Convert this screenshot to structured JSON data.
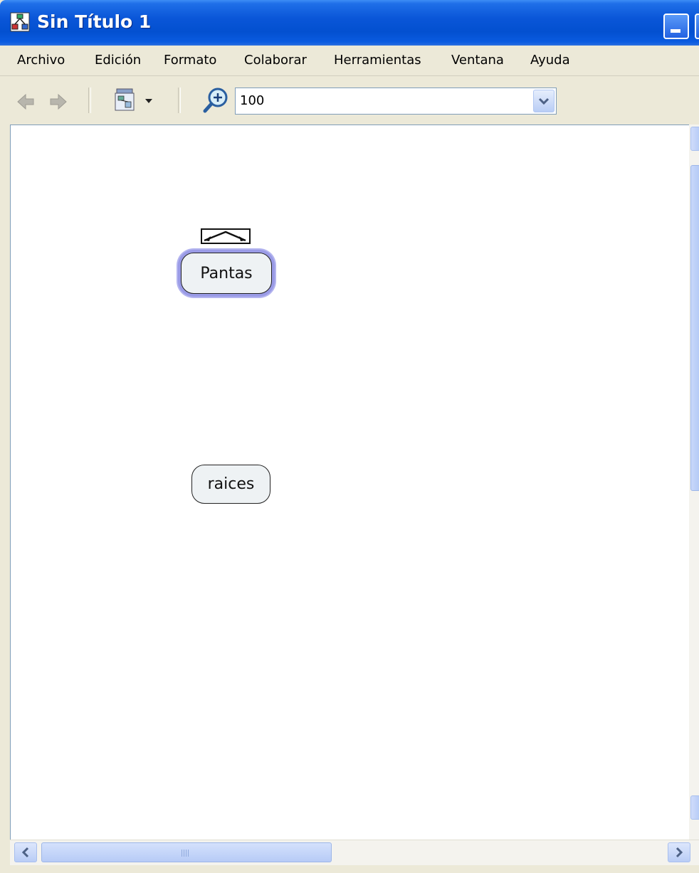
{
  "window": {
    "title": "Sin Título 1",
    "icon": "concept-map-app-icon"
  },
  "menubar": {
    "items": [
      "Archivo",
      "Edición",
      "Formato",
      "Colaborar",
      "Herramientas",
      "Ventana",
      "Ayuda"
    ]
  },
  "toolbar": {
    "back_icon": "arrow-left-icon",
    "forward_icon": "arrow-right-icon",
    "views_icon": "views-dropdown-icon",
    "zoom_icon": "zoom-in-icon",
    "zoom_value": "100"
  },
  "canvas": {
    "nodes": [
      {
        "label": "Pantas",
        "selected": true
      },
      {
        "label": "raices",
        "selected": false
      }
    ]
  },
  "colors": {
    "titlebar": "#0a56d8",
    "selection_halo": "#9a9be6",
    "node_fill": "#eef2f4",
    "chrome": "#ece9d8"
  }
}
